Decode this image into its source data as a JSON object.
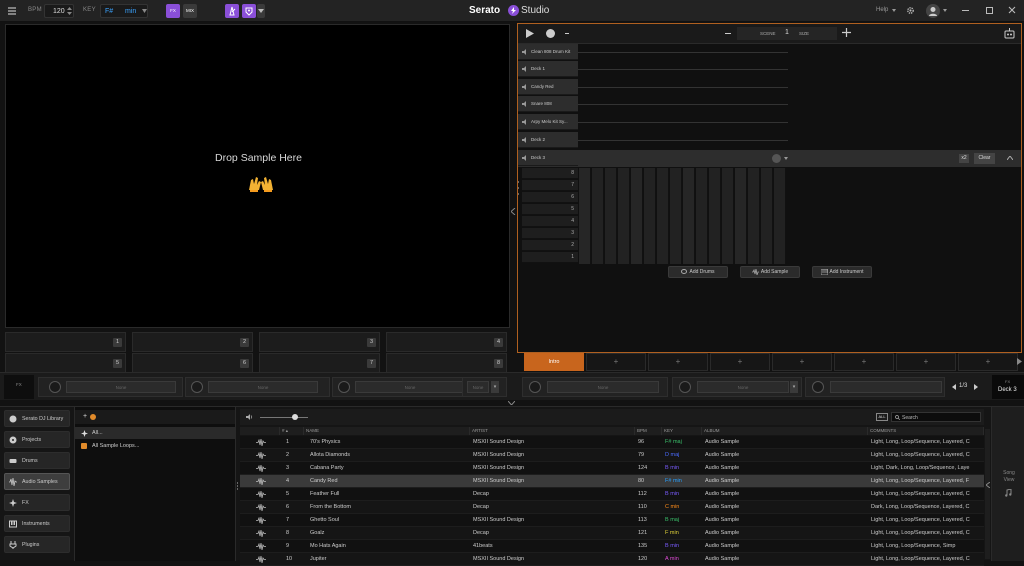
{
  "topbar": {
    "bpm_label": "BPM",
    "bpm_value": "120",
    "key_label": "KEY",
    "key_value": "F#",
    "key_mode": "min",
    "fx_label": "FX",
    "mix_label": "MIX",
    "logo_text": "Serato",
    "logo_suffix": "Studio",
    "help_label": "Help",
    "colors": {
      "accent_purple": "#8a4fd8",
      "accent_orange": "#d4691e",
      "key_blue": "#3aa3ff"
    }
  },
  "drop_area": {
    "text": "Drop Sample Here",
    "emoji": "🙌"
  },
  "pads": [
    {
      "num": "1"
    },
    {
      "num": "2"
    },
    {
      "num": "3"
    },
    {
      "num": "4"
    },
    {
      "num": "5"
    },
    {
      "num": "6"
    },
    {
      "num": "7"
    },
    {
      "num": "8"
    }
  ],
  "sequencer": {
    "scene_label": "SCENE",
    "scene_value": "1",
    "size_label": "SIZE",
    "tracks": [
      {
        "name": "Clean 808 Drum Kit"
      },
      {
        "name": "Deck 1"
      },
      {
        "name": "Candy Red"
      },
      {
        "name": "Snare 808"
      },
      {
        "name": "Arpy Melo Kit Sy..."
      },
      {
        "name": "Deck 2"
      },
      {
        "name": "Deck 3"
      }
    ],
    "expanded_track": {
      "name": "Deck 3",
      "step_count": "x2",
      "clear_label": "Clear"
    },
    "keys": [
      "8",
      "7",
      "6",
      "5",
      "4",
      "3",
      "2",
      "1"
    ],
    "add_buttons": [
      "Add Drums",
      "Add Sample",
      "Add Instrument"
    ],
    "scenes": [
      "Intro",
      "+",
      "+",
      "+",
      "+",
      "+",
      "+",
      "+"
    ]
  },
  "fx": {
    "label": "FX",
    "drops": [
      "None",
      "None",
      "None",
      "None",
      "None",
      "None"
    ],
    "page": "1/3",
    "deck": "Deck 3"
  },
  "library": {
    "sidebar": [
      {
        "label": "Serato DJ Library"
      },
      {
        "label": "Projects"
      },
      {
        "label": "Drums"
      },
      {
        "label": "Audio Samples",
        "active": true
      },
      {
        "label": "FX"
      },
      {
        "label": "Instruments"
      },
      {
        "label": "Plugins"
      }
    ],
    "tree": [
      {
        "label": "All..."
      },
      {
        "label": "All Sample Loops..."
      }
    ],
    "search_placeholder": "Search",
    "search_all": "ALL",
    "columns": [
      "#",
      "NAME",
      "ARTIST",
      "BPM",
      "KEY",
      "ALBUM",
      "COMMENTS"
    ],
    "rows": [
      {
        "num": "1",
        "name": "70's Physics",
        "artist": "MSXII Sound Design",
        "bpm": "96",
        "key": "F# maj",
        "key_color": "#3bc06b",
        "album": "Audio Sample",
        "comments": "Light, Long, Loop/Sequence, Layered, C"
      },
      {
        "num": "2",
        "name": "Allota Diamonds",
        "artist": "MSXII Sound Design",
        "bpm": "79",
        "key": "D maj",
        "key_color": "#4b6cff",
        "album": "Audio Sample",
        "comments": "Light, Long, Loop/Sequence, Layered, C"
      },
      {
        "num": "3",
        "name": "Cabana Party",
        "artist": "MSXII Sound Design",
        "bpm": "124",
        "key": "B min",
        "key_color": "#7a5cff",
        "album": "Audio Sample",
        "comments": "Light, Dark, Long, Loop/Sequence, Laye"
      },
      {
        "num": "4",
        "name": "Candy Red",
        "artist": "MSXII Sound Design",
        "bpm": "80",
        "key": "F# min",
        "key_color": "#28a0ff",
        "album": "Audio Sample",
        "comments": "Light, Long, Loop/Sequence, Layered, F"
      },
      {
        "num": "5",
        "name": "Feather Full",
        "artist": "Decap",
        "bpm": "112",
        "key": "B min",
        "key_color": "#7a5cff",
        "album": "Audio Sample",
        "comments": "Light, Long, Loop/Sequence, Layered, C"
      },
      {
        "num": "6",
        "name": "From the Bottom",
        "artist": "Decap",
        "bpm": "110",
        "key": "C min",
        "key_color": "#ff8c1a",
        "album": "Audio Sample",
        "comments": "Dark, Long, Loop/Sequence, Layered, C"
      },
      {
        "num": "7",
        "name": "Ghetto Soul",
        "artist": "MSXII Sound Design",
        "bpm": "113",
        "key": "B maj",
        "key_color": "#3bc06b",
        "album": "Audio Sample",
        "comments": "Light, Long, Loop/Sequence, Layered, C"
      },
      {
        "num": "8",
        "name": "Goalz",
        "artist": "Decap",
        "bpm": "121",
        "key": "F min",
        "key_color": "#e0d23a",
        "album": "Audio Sample",
        "comments": "Light, Long, Loop/Sequence, Layered, C"
      },
      {
        "num": "9",
        "name": "Mo Hats Again",
        "artist": "41beats",
        "bpm": "135",
        "key": "B min",
        "key_color": "#7a5cff",
        "album": "Audio Sample",
        "comments": "Light, Long, Loop/Sequence, Simp"
      },
      {
        "num": "10",
        "name": "Jupiter",
        "artist": "MSXII Sound Design",
        "bpm": "120",
        "key": "A min",
        "key_color": "#e04bd8",
        "album": "Audio Sample",
        "comments": "Light, Long, Loop/Sequence, Layered, C"
      }
    ],
    "song_view_label": "Song View"
  }
}
